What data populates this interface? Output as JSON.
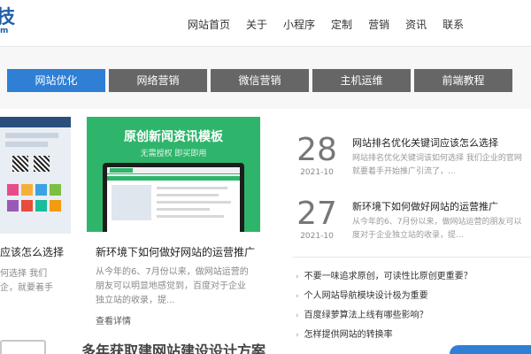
{
  "header": {
    "logo_text": "技",
    "logo_sub": "m",
    "nav": [
      "网站首页",
      "关于",
      "小程序",
      "定制",
      "营销",
      "资讯",
      "联系"
    ]
  },
  "tabs": [
    {
      "label": "网站优化",
      "active": true
    },
    {
      "label": "网络营销",
      "active": false
    },
    {
      "label": "微信营销",
      "active": false
    },
    {
      "label": "主机运维",
      "active": false
    },
    {
      "label": "前端教程",
      "active": false
    }
  ],
  "left_card": {
    "title": "应该怎么选择",
    "desc": "何选择 我们企，就要着手开"
  },
  "feature_card": {
    "image_title": "原创新闻资讯模板",
    "image_sub": "无需授权  即买即用",
    "title": "新环境下如何做好网站的运营推广",
    "desc": "从今年的6、7月份以来，做网站运营的朋友可以明显地感觉到，百度对于企业独立站的收录，提...",
    "more": "查看详情"
  },
  "news": [
    {
      "day": "28",
      "ym": "2021-10",
      "title": "网站排名优化关键词应该怎么选择",
      "desc": "网站排名优化关键词该如何选择 我们企业的官网 就要着手开始推广引流了，..."
    },
    {
      "day": "27",
      "ym": "2021-10",
      "title": "新环境下如何做好网站的运营推广",
      "desc": "从今年的6、7月份以来，做网站运营的朋友可以 度对于企业独立站的收录，提..."
    }
  ],
  "list": [
    "不要一味追求原创，可读性比原创更重要？",
    "个人网站导航模块设计极为重要",
    "百度绿萝算法上线有哪些影响？",
    "怎样提供网站的转换率"
  ],
  "bottom": {
    "text": "多年获取建网站建设设计方案"
  },
  "colors": {
    "accent": "#2f7fd4",
    "tab_inactive": "#666666",
    "template_green": "#2fb56b"
  }
}
